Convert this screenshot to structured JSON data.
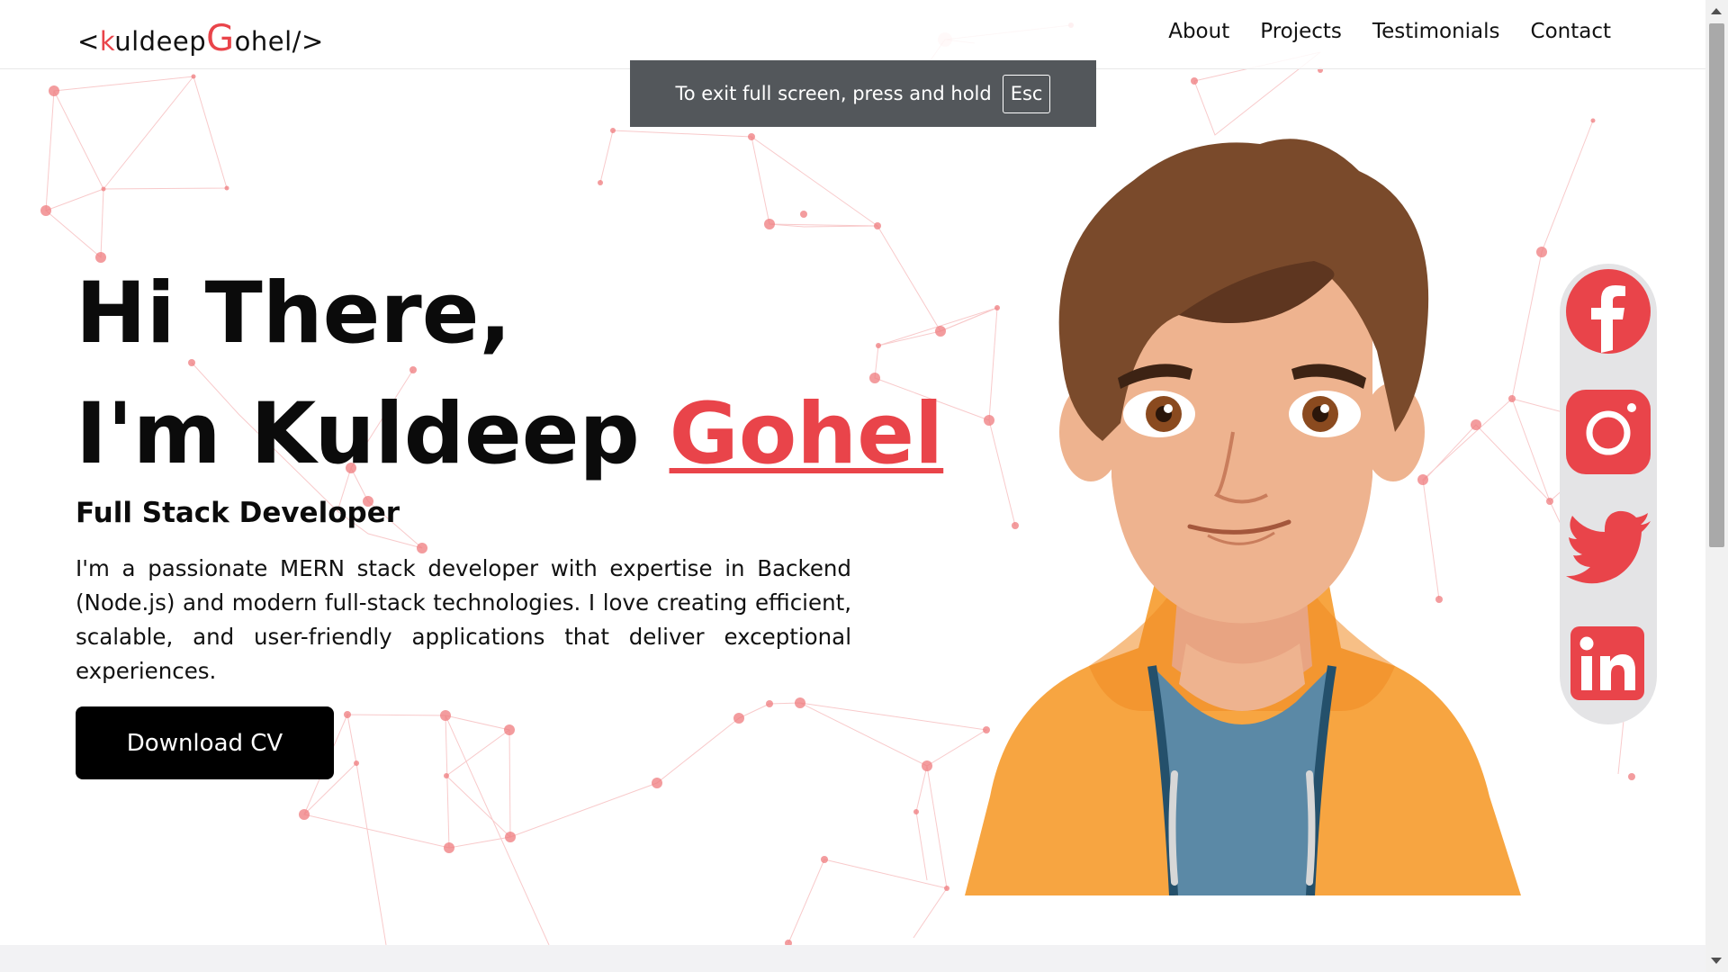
{
  "header": {
    "logo": {
      "open": "<",
      "k": "k",
      "uldeep": "uldeep",
      "g": "G",
      "ohel": "ohel/>"
    },
    "nav": [
      "About",
      "Projects",
      "Testimonials",
      "Contact"
    ]
  },
  "fullscreen_toast": {
    "text": "To exit full screen, press and hold",
    "key": "Esc"
  },
  "hero": {
    "line1": "Hi There,",
    "line2_prefix": "I'm Kuldeep ",
    "line2_highlight": "Gohel",
    "role": "Full Stack Developer",
    "bio": "I'm a passionate MERN stack developer with expertise in Backend (Node.js) and modern full-stack technologies. I love creating efficient, scalable, and user-friendly applications that deliver exceptional experiences.",
    "cta": "Download CV"
  },
  "social": [
    "facebook-icon",
    "instagram-icon",
    "twitter-icon",
    "linkedin-icon"
  ],
  "colors": {
    "accent": "#e9444a",
    "text": "#111111",
    "button_bg": "#000000",
    "toast_bg": "#53575b",
    "social_bar_bg": "#e4e4e6",
    "hoodie": "#f7a541",
    "shirt": "#5b89a6",
    "hair": "#7a4a2b",
    "skin": "#eeb38f"
  }
}
